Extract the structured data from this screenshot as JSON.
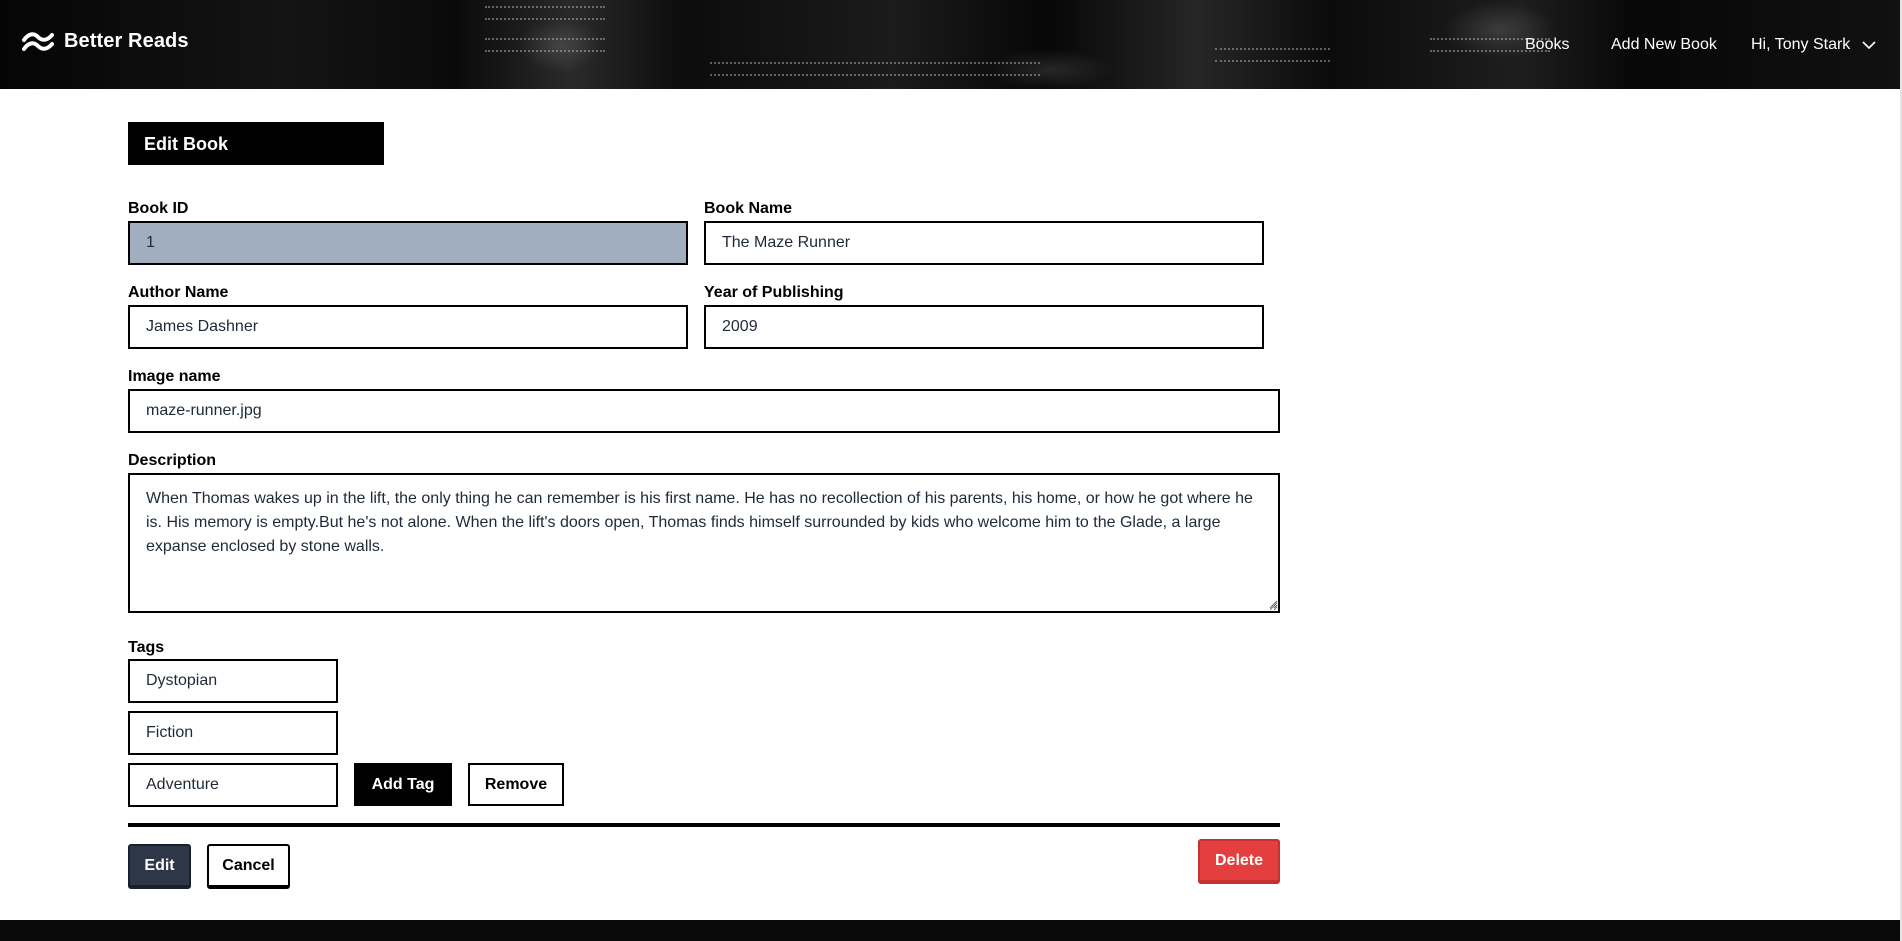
{
  "app": {
    "name": "Better Reads",
    "logo_icon": "wave-logo-icon"
  },
  "nav": {
    "books": "Books",
    "add_new_book": "Add New Book",
    "user_greeting": "Hi, Tony Stark",
    "user_menu_icon": "chevron-down-icon"
  },
  "form": {
    "title": "Edit Book",
    "book_id": {
      "label": "Book ID",
      "value": "1"
    },
    "book_name": {
      "label": "Book Name",
      "value": "The Maze Runner"
    },
    "author_name": {
      "label": "Author Name",
      "value": "James Dashner"
    },
    "year": {
      "label": "Year of Publishing",
      "value": "2009"
    },
    "image_name": {
      "label": "Image name",
      "value": "maze-runner.jpg"
    },
    "description": {
      "label": "Description",
      "value": "When Thomas wakes up in the lift, the only thing he can remember is his first name. He has no recollection of his parents, his home, or how he got where he is. His memory is empty.But he's not alone. When the lift's doors open, Thomas finds himself surrounded by kids who welcome him to the Glade, a large expanse enclosed by stone walls."
    },
    "tags": {
      "label": "Tags",
      "items": [
        "Dystopian",
        "Fiction",
        "Adventure"
      ],
      "add_label": "Add Tag",
      "remove_label": "Remove"
    },
    "actions": {
      "edit_label": "Edit",
      "cancel_label": "Cancel",
      "delete_label": "Delete"
    }
  },
  "colors": {
    "header_bg": "#0a0a0a",
    "readonly_bg": "#a1aebf",
    "edit_btn": "#2d3748",
    "delete_btn": "#e53e3e"
  }
}
